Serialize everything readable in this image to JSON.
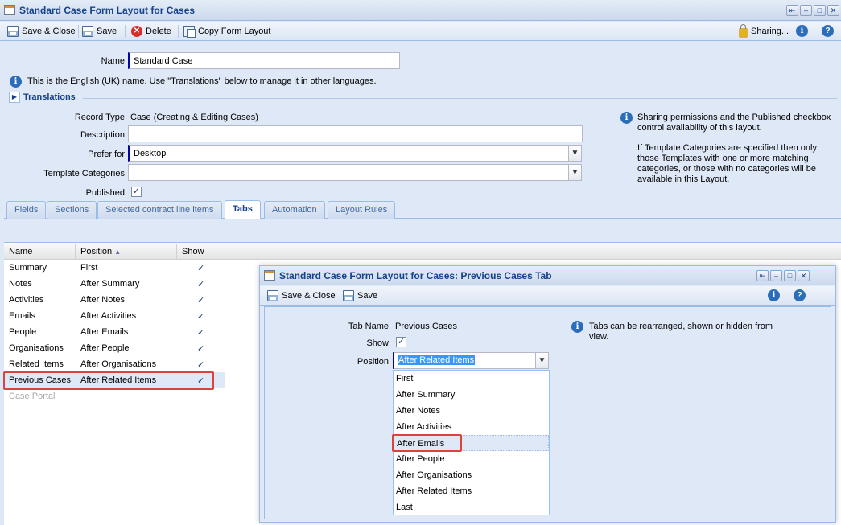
{
  "window": {
    "title": "Standard Case Form Layout for Cases",
    "toolbar": {
      "save_close": "Save & Close",
      "save": "Save",
      "delete": "Delete",
      "copy": "Copy Form Layout",
      "sharing": "Sharing...",
      "info_icon": "i",
      "help_icon": "?"
    }
  },
  "form": {
    "name_label": "Name",
    "name_value": "Standard Case",
    "name_info": "This is the English (UK) name. Use \"Translations\" below to manage it in other languages.",
    "translations_label": "Translations",
    "record_type_label": "Record Type",
    "record_type_value": "Case (Creating & Editing Cases)",
    "description_label": "Description",
    "description_value": "",
    "prefer_for_label": "Prefer for",
    "prefer_for_value": "Desktop",
    "template_categories_label": "Template Categories",
    "template_categories_value": "",
    "published_label": "Published",
    "published_checked": true,
    "side_info_1": "Sharing permissions and the Published checkbox control availability of this layout.",
    "side_info_2": "If Template Categories are specified then only those Templates with one or more matching categories, or those with no categories will be available in this Layout."
  },
  "tabs": [
    {
      "label": "Fields",
      "active": false
    },
    {
      "label": "Sections",
      "active": false
    },
    {
      "label": "Selected contract line items",
      "active": false
    },
    {
      "label": "Tabs",
      "active": true
    },
    {
      "label": "Automation",
      "active": false
    },
    {
      "label": "Layout Rules",
      "active": false
    }
  ],
  "grid": {
    "columns": {
      "name": "Name",
      "position": "Position",
      "show": "Show"
    },
    "sort_icon": "▲",
    "rows": [
      {
        "name": "Summary",
        "position": "First",
        "show": "✓"
      },
      {
        "name": "Notes",
        "position": "After Summary",
        "show": "✓"
      },
      {
        "name": "Activities",
        "position": "After Notes",
        "show": "✓"
      },
      {
        "name": "Emails",
        "position": "After Activities",
        "show": "✓"
      },
      {
        "name": "People",
        "position": "After Emails",
        "show": "✓"
      },
      {
        "name": "Organisations",
        "position": "After People",
        "show": "✓"
      },
      {
        "name": "Related Items",
        "position": "After Organisations",
        "show": "✓"
      },
      {
        "name": "Previous Cases",
        "position": "After Related Items",
        "show": "✓"
      },
      {
        "name": "Case Portal",
        "position": "",
        "show": ""
      }
    ]
  },
  "dialog": {
    "title": "Standard Case Form Layout for Cases: Previous Cases Tab",
    "save_close": "Save & Close",
    "save": "Save",
    "tab_name_label": "Tab Name",
    "tab_name_value": "Previous Cases",
    "show_label": "Show",
    "show_checked": true,
    "position_label": "Position",
    "position_value": "After Related Items",
    "info_text": "Tabs can be rearranged, shown or hidden from view.",
    "options": [
      "First",
      "After Summary",
      "After Notes",
      "After Activities",
      "After Emails",
      "After People",
      "After Organisations",
      "After Related Items",
      "Last"
    ],
    "hover_option": "After Emails"
  },
  "colors": {
    "highlight": "#d9453d",
    "accent": "#15428b",
    "background": "#dfe8f6"
  }
}
